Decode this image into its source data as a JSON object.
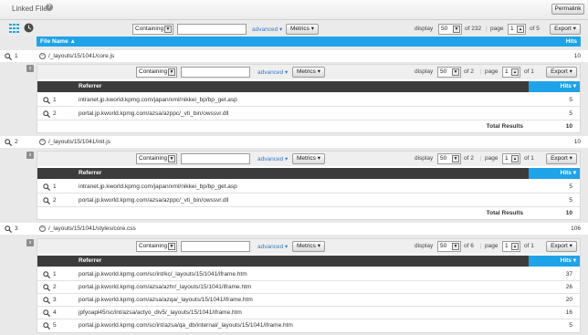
{
  "title": "Linked Files",
  "help_glyph": "?",
  "permalink": "Permalink",
  "toolbar": {
    "containing": "Containing",
    "advanced": "advanced",
    "metrics": "Metrics",
    "display": "display",
    "display_count": "50",
    "of_total": "of 232",
    "page_label": "page",
    "page": "1",
    "of_pages": "of 5",
    "export": "Export"
  },
  "main_header": {
    "col1": "File Name",
    "col2": "Hits"
  },
  "sub_header": {
    "col1": "Referrer",
    "col2": "Hits"
  },
  "groups": [
    {
      "num": "1",
      "name": "/_layouts/15/1041/core.js",
      "hits": "10",
      "toolbar": {
        "display_count": "50",
        "of_total": "of 2",
        "page": "1",
        "of_pages": "of 1"
      },
      "rows": [
        {
          "num": "1",
          "ref": "intranet.jp.kworld.kpmg.com/japan/xml/nikkei_bp/bp_get.asp",
          "hits": "5"
        },
        {
          "num": "2",
          "ref": "portal.jp.kworld.kpmg.com/azsa/azppc/_vti_bin/owssvr.dll",
          "hits": "5"
        }
      ],
      "total_label": "Total Results",
      "total": "10"
    },
    {
      "num": "2",
      "name": "/_layouts/15/1041/init.js",
      "hits": "10",
      "toolbar": {
        "display_count": "50",
        "of_total": "of 2",
        "page": "1",
        "of_pages": "of 1"
      },
      "rows": [
        {
          "num": "1",
          "ref": "intranet.jp.kworld.kpmg.com/japan/xml/nikkei_bp/bp_get.asp",
          "hits": "5"
        },
        {
          "num": "2",
          "ref": "portal.jp.kworld.kpmg.com/azsa/azppc/_vti_bin/owssvr.dll",
          "hits": "5"
        }
      ],
      "total_label": "Total Results",
      "total": "10"
    },
    {
      "num": "3",
      "name": "/_layouts/15/1041/styles/core.css",
      "hits": "106",
      "toolbar": {
        "display_count": "50",
        "of_total": "of 6",
        "page": "1",
        "of_pages": "of 1"
      },
      "rows": [
        {
          "num": "1",
          "ref": "portal.jp.kworld.kpmg.com/sc/int/kc/_layouts/15/1041/iframe.htm",
          "hits": "37"
        },
        {
          "num": "2",
          "ref": "portal.jp.kworld.kpmg.com/azsa/azhr/_layouts/15/1041/iframe.htm",
          "hits": "26"
        },
        {
          "num": "3",
          "ref": "portal.jp.kworld.kpmg.com/azsa/azqa/_layouts/15/1041/iframe.htm",
          "hits": "20"
        },
        {
          "num": "4",
          "ref": "jpfyoapl45/sc/int/azsa/actyo_div5/_layouts/15/1041/iframe.htm",
          "hits": "16"
        },
        {
          "num": "5",
          "ref": "portal.jp.kworld.kpmg.com/sc/int/azsa/qa_db/internal/_layouts/15/1041/iframe.htm",
          "hits": "5"
        }
      ]
    }
  ]
}
